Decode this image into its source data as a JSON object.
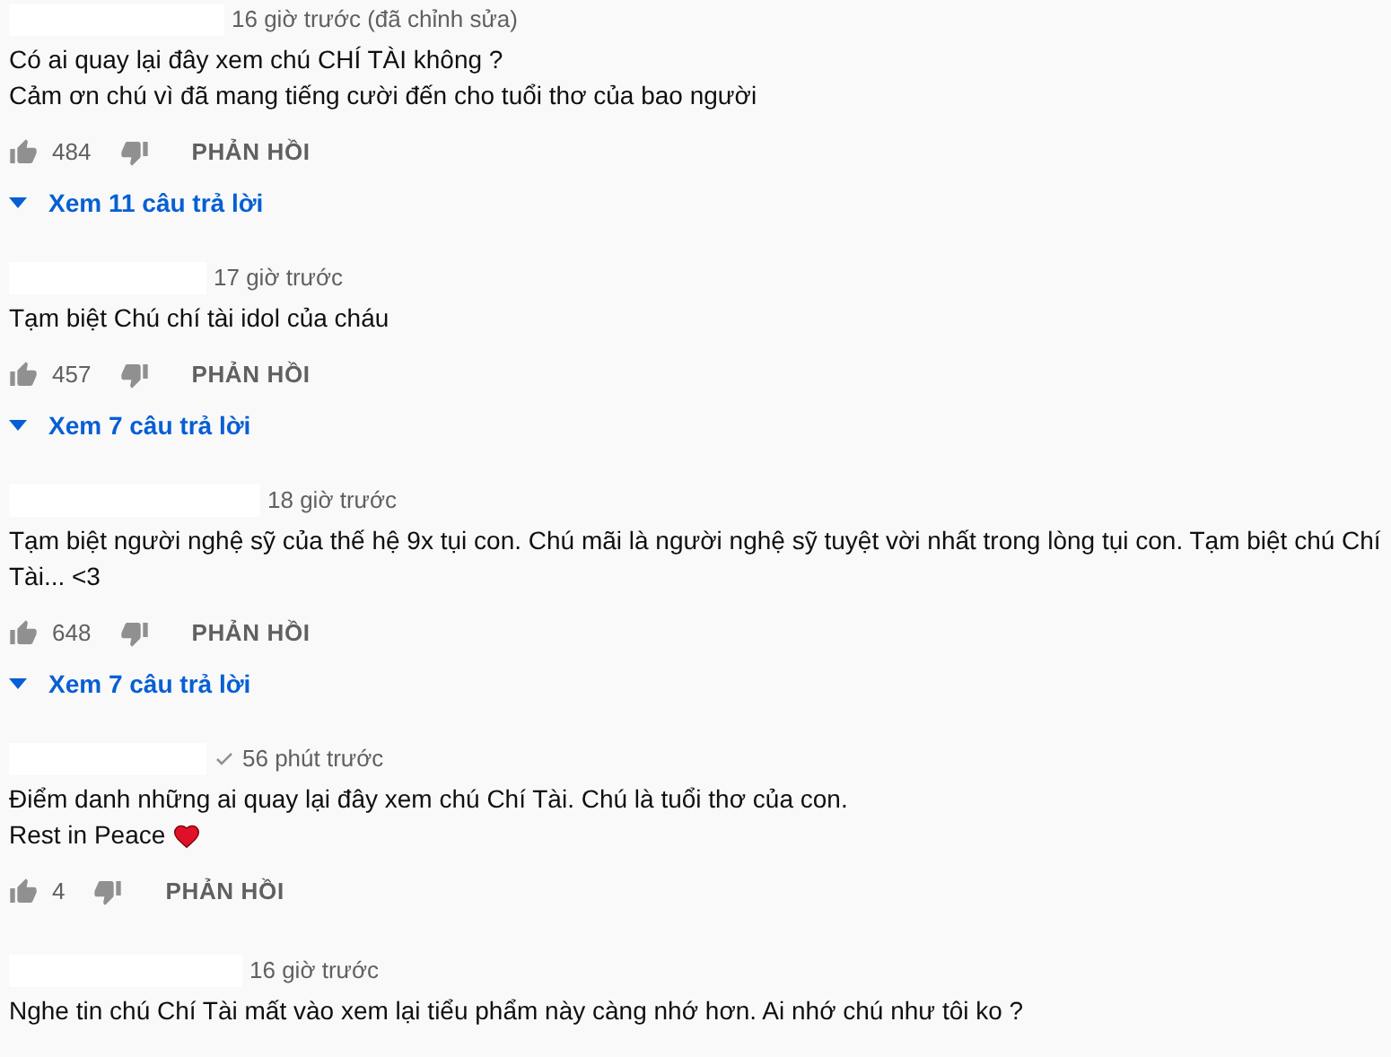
{
  "comments": [
    {
      "time": "16 giờ trước (đã chỉnh sửa)",
      "verified": false,
      "lines": [
        "Có ai quay lại đây xem chú CHÍ TÀI không ?",
        "Cảm ơn chú vì đã mang tiếng cười đến cho tuổi thơ của bao người"
      ],
      "heart": false,
      "likes": "484",
      "reply": "PHẢN HỒI",
      "replies": "Xem 11 câu trả lời"
    },
    {
      "time": "17 giờ trước",
      "verified": false,
      "lines": [
        "Tạm biệt Chú chí tài idol của cháu"
      ],
      "heart": false,
      "likes": "457",
      "reply": "PHẢN HỒI",
      "replies": "Xem 7 câu trả lời"
    },
    {
      "time": "18 giờ trước",
      "verified": false,
      "lines": [
        "Tạm biệt người nghệ sỹ của thế hệ 9x tụi con. Chú mãi là người nghệ sỹ tuyệt vời nhất trong lòng tụi con. Tạm biệt chú Chí Tài... <3"
      ],
      "heart": false,
      "likes": "648",
      "reply": "PHẢN HỒI",
      "replies": "Xem 7 câu trả lời"
    },
    {
      "time": "56 phút trước",
      "verified": true,
      "lines": [
        "Điểm danh những ai quay lại đây xem chú Chí Tài. Chú là tuổi thơ của con.",
        "Rest in Peace"
      ],
      "heart": true,
      "likes": "4",
      "reply": "PHẢN HỒI"
    },
    {
      "time": "16 giờ trước",
      "verified": false,
      "lines": [
        "Nghe tin chú Chí Tài mất vào xem lại tiểu phẩm này càng nhớ hơn. Ai nhớ chú như tôi ko ?"
      ],
      "heart": false
    }
  ]
}
